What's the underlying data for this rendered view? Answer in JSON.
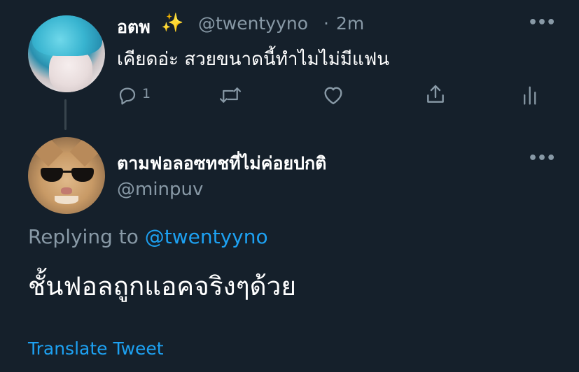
{
  "colors": {
    "background": "#15202b",
    "primary_text": "#ffffff",
    "secondary_text": "#8899a6",
    "accent": "#1da1f2"
  },
  "parent_tweet": {
    "display_name": "อตพ",
    "emoji": "✨",
    "handle": "@twentyyno",
    "separator": "·",
    "time": "2m",
    "more": "•••",
    "text": "เคียดอ่ะ สวยขนาดนี้ทำไมไม่มีแฟน",
    "actions": {
      "reply_icon": "reply-icon",
      "reply_count": "1",
      "retweet_icon": "retweet-icon",
      "like_icon": "heart-icon",
      "share_icon": "share-icon",
      "stats_icon": "analytics-icon"
    }
  },
  "reply_tweet": {
    "display_name": "ตามฟอลอซทชที่ไม่ค่อยปกติ",
    "handle": "@minpuv",
    "more": "•••",
    "replying_prefix": "Replying to",
    "replying_mention": "@twentyyno",
    "text": "ชั้นฟอลถูกแอคจริงๆด้วย",
    "translate_label": "Translate Tweet"
  }
}
